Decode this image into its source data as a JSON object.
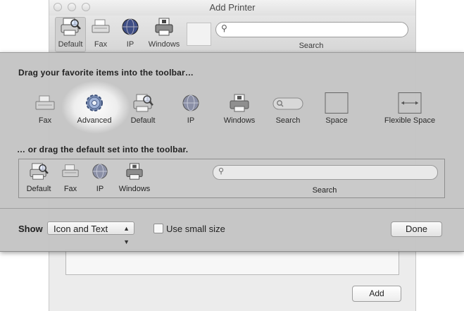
{
  "window": {
    "title": "Add Printer",
    "toolbar": [
      {
        "label": "Default",
        "icon": "printer-magnify-icon"
      },
      {
        "label": "Fax",
        "icon": "fax-icon"
      },
      {
        "label": "IP",
        "icon": "globe-icon"
      },
      {
        "label": "Windows",
        "icon": "windows-printer-icon"
      }
    ],
    "search_label": "Search",
    "add_button": "Add"
  },
  "sheet": {
    "drag_heading": "Drag your favorite items into the toolbar…",
    "items": [
      {
        "label": "Fax",
        "icon": "fax-icon"
      },
      {
        "label": "Advanced",
        "icon": "gear-icon"
      },
      {
        "label": "Default",
        "icon": "printer-magnify-icon"
      },
      {
        "label": "IP",
        "icon": "globe-icon"
      },
      {
        "label": "Windows",
        "icon": "windows-printer-icon"
      },
      {
        "label": "Search",
        "icon": "search-field-icon"
      },
      {
        "label": "Space",
        "icon": "space-icon"
      },
      {
        "label": "Flexible Space",
        "icon": "flexible-space-icon"
      }
    ],
    "default_heading": "… or drag the default set into the toolbar.",
    "default_set": [
      {
        "label": "Default",
        "icon": "printer-magnify-icon"
      },
      {
        "label": "Fax",
        "icon": "fax-icon"
      },
      {
        "label": "IP",
        "icon": "globe-icon"
      },
      {
        "label": "Windows",
        "icon": "windows-printer-icon"
      }
    ],
    "default_search_label": "Search",
    "show_label": "Show",
    "show_value": "Icon and Text",
    "small_size_label": "Use small size",
    "done_button": "Done"
  },
  "colors": {
    "sheet_bg": "#c4c4c4",
    "window_bg": "#ececec",
    "text": "#222222"
  }
}
